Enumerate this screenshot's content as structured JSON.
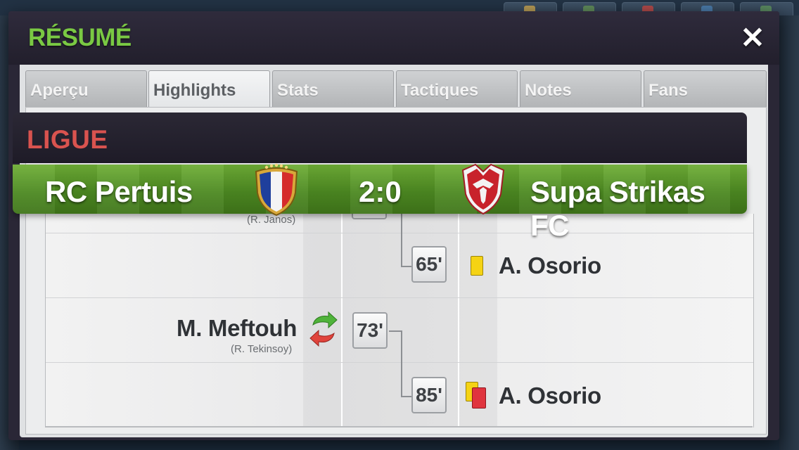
{
  "modal": {
    "title": "RÉSUMÉ",
    "close_label": "✕"
  },
  "tabs": [
    {
      "label": "Aperçu",
      "active": false
    },
    {
      "label": "Highlights",
      "active": true
    },
    {
      "label": "Stats",
      "active": false
    },
    {
      "label": "Tactiques",
      "active": false
    },
    {
      "label": "Notes",
      "active": false
    },
    {
      "label": "Fans",
      "active": false
    }
  ],
  "league": {
    "title": "LIGUE"
  },
  "match": {
    "home_team": "RC Pertuis",
    "away_team": "Supa Strikas FC",
    "score": "2:0"
  },
  "events": {
    "partial_top_sub": "(R. Janos)",
    "e1": {
      "minute": "65'",
      "player": "A. Osorio",
      "type": "yellow-card"
    },
    "e2": {
      "minute": "73'",
      "player": "M. Meftouh",
      "sub_for": "(R. Tekinsoy)",
      "type": "substitution"
    },
    "e3": {
      "minute": "85'",
      "player": "A. Osorio",
      "type": "second-yellow-red-card"
    }
  },
  "colors": {
    "title_green": "#7ac943",
    "league_red": "#d9534f",
    "pitch_green": "#4d8a22",
    "card_yellow": "#f5d314",
    "card_red": "#e0343e"
  }
}
